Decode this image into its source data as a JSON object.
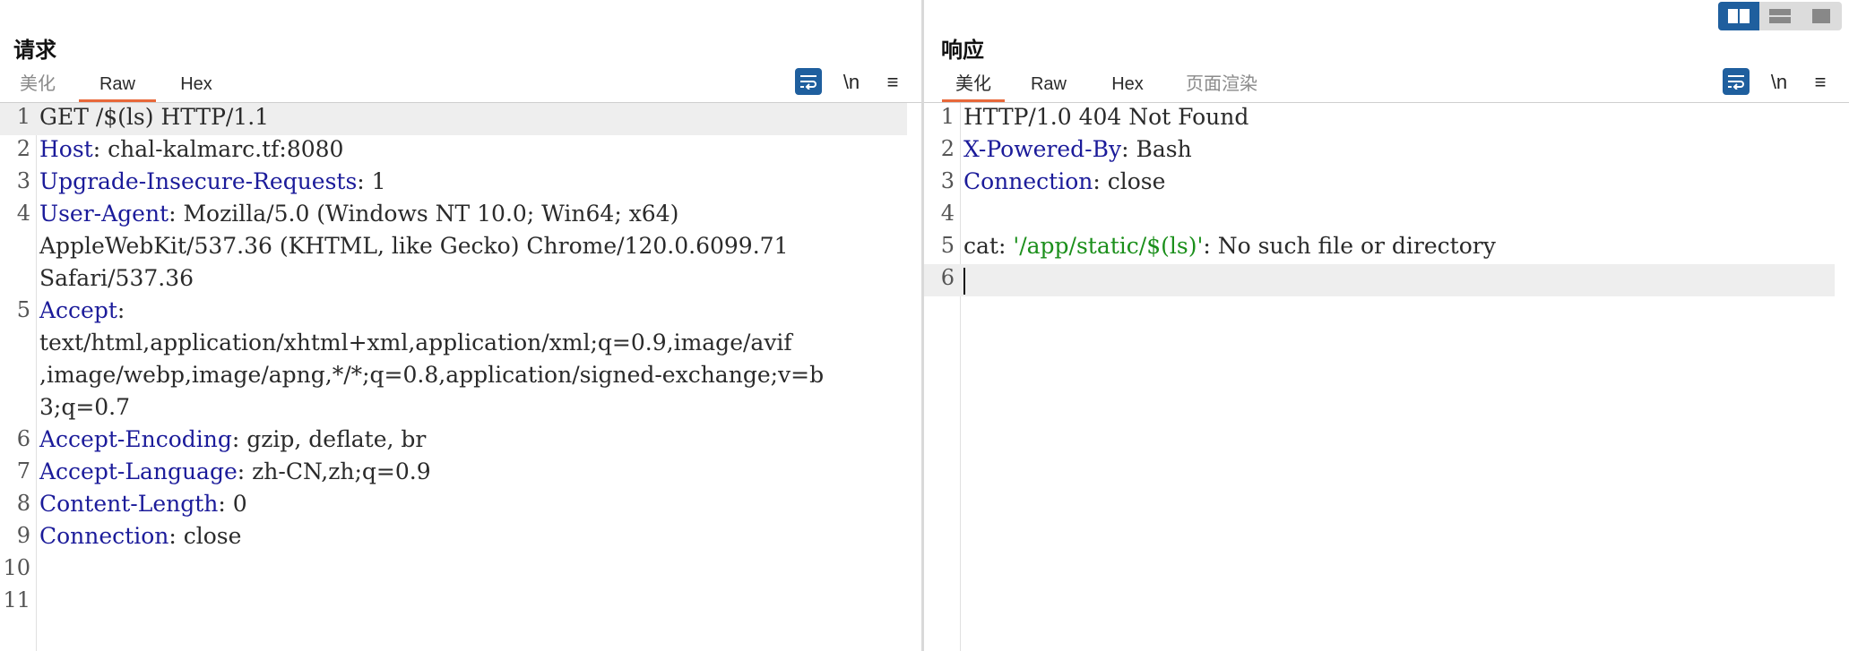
{
  "view_toggle": {
    "options": [
      "split-horizontal",
      "split-vertical",
      "single"
    ],
    "active": "split-horizontal"
  },
  "request": {
    "title": "请求",
    "tabs": [
      {
        "label": "美化",
        "active": false
      },
      {
        "label": "Raw",
        "active": true
      },
      {
        "label": "Hex",
        "active": false
      }
    ],
    "tools": {
      "newline_label": "\\n"
    },
    "lines": [
      {
        "num": "1",
        "text": "GET /$(ls) HTTP/1.1"
      },
      {
        "num": "2",
        "name": "Host",
        "value": ": chal-kalmarc.tf:8080"
      },
      {
        "num": "3",
        "name": "Upgrade-Insecure-Requests",
        "value": ": 1"
      },
      {
        "num": "4",
        "name": "User-Agent",
        "value": ": Mozilla/5.0 (Windows NT 10.0; Win64; x64)",
        "cont": [
          "AppleWebKit/537.36 (KHTML, like Gecko) Chrome/120.0.6099.71",
          "Safari/537.36"
        ]
      },
      {
        "num": "5",
        "name": "Accept",
        "value": ":",
        "cont": [
          "text/html,application/xhtml+xml,application/xml;q=0.9,image/avif",
          ",image/webp,image/apng,*/*;q=0.8,application/signed-exchange;v=b",
          "3;q=0.7"
        ]
      },
      {
        "num": "6",
        "name": "Accept-Encoding",
        "value": ": gzip, deflate, br"
      },
      {
        "num": "7",
        "name": "Accept-Language",
        "value": ": zh-CN,zh;q=0.9"
      },
      {
        "num": "8",
        "name": "Content-Length",
        "value": ": 0"
      },
      {
        "num": "9",
        "name": "Connection",
        "value": ": close"
      },
      {
        "num": "10",
        "text": ""
      },
      {
        "num": "11",
        "text": ""
      }
    ]
  },
  "response": {
    "title": "响应",
    "tabs": [
      {
        "label": "美化",
        "active": true
      },
      {
        "label": "Raw",
        "active": false
      },
      {
        "label": "Hex",
        "active": false
      },
      {
        "label": "页面渲染",
        "active": false
      }
    ],
    "tools": {
      "newline_label": "\\n"
    },
    "lines": [
      {
        "num": "1",
        "text": "HTTP/1.0 404 Not Found"
      },
      {
        "num": "2",
        "name": "X-Powered-By",
        "value": ": Bash"
      },
      {
        "num": "3",
        "name": "Connection",
        "value": ": close"
      },
      {
        "num": "4",
        "text": ""
      },
      {
        "num": "5",
        "prefix": "cat: ",
        "str": "'/app/static/$(ls)'",
        "suffix": ": No such file or directory"
      },
      {
        "num": "6",
        "text": ""
      }
    ]
  }
}
